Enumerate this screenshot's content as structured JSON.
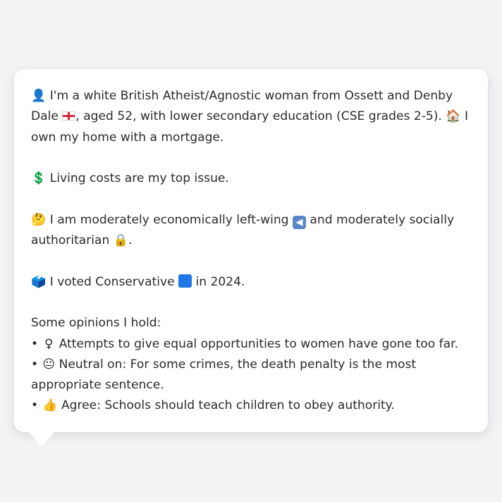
{
  "profile": {
    "identity_pre": "I'm a white British Atheist/Agnostic woman from Ossett and Denby Dale",
    "identity_post": ", aged 52, with lower secondary education (CSE grades 2-5).",
    "home": "I own my home with a mortgage.",
    "issue": "Living costs are my top issue.",
    "ideology_pre": "I am moderately economically left-wing",
    "ideology_mid": "and moderately socially authoritarian",
    "ideology_end": ".",
    "vote_pre": "I voted Conservative",
    "vote_post": "in 2024.",
    "opinions_heading": "Some opinions I hold:",
    "opinions": [
      {
        "icon": "♀",
        "text": "Attempts to give equal opportunities to women have gone too far."
      },
      {
        "icon": "😐",
        "text": "Neutral on: For some crimes, the death penalty is the most appropriate sentence."
      },
      {
        "icon": "👍",
        "text": "Agree: Schools should teach children to obey authority."
      }
    ],
    "bullet": "•"
  },
  "icons": {
    "person": "👤",
    "home": "🏠",
    "money": "💲",
    "thinking": "🤔",
    "lock": "🔒",
    "ballot": "🗳️"
  },
  "colors": {
    "flag_red": "#d7263d",
    "conservative_blue": "#1f78e6",
    "arrow_box": "#5a86c8",
    "card_bg": "#ffffff",
    "page_bg": "#f2f3f5"
  }
}
